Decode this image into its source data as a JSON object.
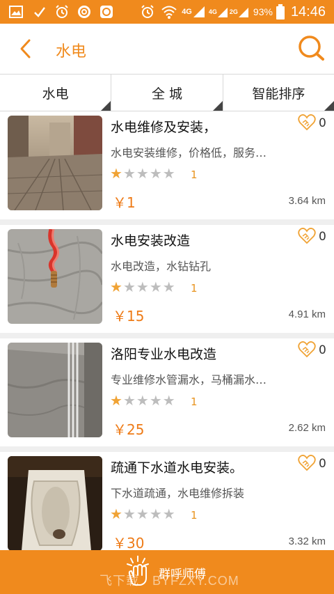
{
  "status_bar": {
    "network_a": "4G",
    "network_b": "4G",
    "network_c": "2G",
    "battery": "93%",
    "time": "14:46"
  },
  "header": {
    "title": "水电"
  },
  "filters": [
    {
      "label": "水电"
    },
    {
      "label": "全 城"
    },
    {
      "label": "智能排序"
    }
  ],
  "items": [
    {
      "name": "水电维修及安装，",
      "desc": "水电安装维修，价格低，服务…",
      "rating": 1,
      "rating_count": "1",
      "price": "￥1",
      "distance": "3.64 km",
      "favorites": "0"
    },
    {
      "name": "水电安装改造",
      "desc": "水电改造，水钻钻孔",
      "rating": 1,
      "rating_count": "1",
      "price": "￥15",
      "distance": "4.91 km",
      "favorites": "0"
    },
    {
      "name": "洛阳专业水电改造",
      "desc": "专业维修水管漏水，马桶漏水…",
      "rating": 1,
      "rating_count": "1",
      "price": "￥25",
      "distance": "2.62 km",
      "favorites": "0"
    },
    {
      "name": "疏通下水道水电安装。",
      "desc": "下水道疏通，水电维修拆装",
      "rating": 1,
      "rating_count": "1",
      "price": "￥30",
      "distance": "3.32 km",
      "favorites": "0"
    }
  ],
  "bottom_bar": {
    "label": "群呼师傅",
    "watermark": "飞下载 · BYFZXY.COM"
  },
  "colors": {
    "accent": "#f08a1d",
    "star_on": "#f0a335",
    "star_off": "#bdbdbd",
    "price": "#ee7b17"
  }
}
